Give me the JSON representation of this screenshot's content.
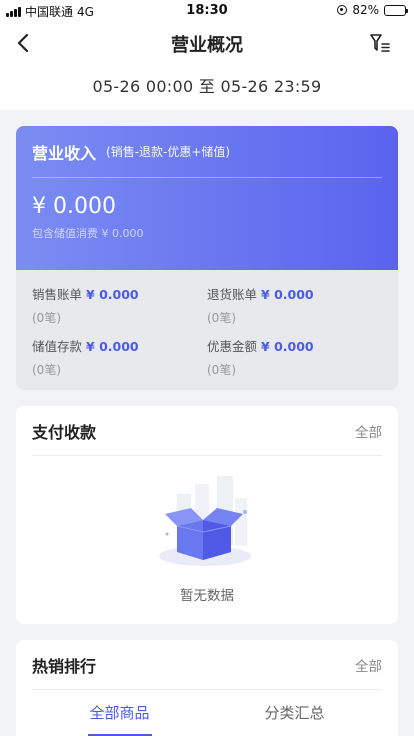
{
  "status": {
    "carrier": "中国联通",
    "network": "4G",
    "time": "18:30",
    "battery_pct": 0.82,
    "battery_label": "82%"
  },
  "nav": {
    "title": "营业概况"
  },
  "date_range": "05-26 00:00 至 05-26 23:59",
  "revenue": {
    "title": "营业收入",
    "formula": "(销售-退款-优惠+储值)",
    "amount": "¥ 0.000",
    "subtext": "包含储值消费 ¥ 0.000",
    "stats": [
      {
        "label": "销售账单",
        "value": "¥ 0.000",
        "count": "(0笔)"
      },
      {
        "label": "退货账单",
        "value": "¥ 0.000",
        "count": "(0笔)"
      },
      {
        "label": "储值存款",
        "value": "¥ 0.000",
        "count": "(0笔)"
      },
      {
        "label": "优惠金额",
        "value": "¥ 0.000",
        "count": "(0笔)"
      }
    ]
  },
  "payment": {
    "title": "支付收款",
    "link": "全部",
    "empty_text": "暂无数据",
    "icon": "empty-box-icon"
  },
  "hot": {
    "title": "热销排行",
    "link": "全部",
    "tabs": [
      "全部商品",
      "分类汇总"
    ],
    "active_tab": 0
  },
  "colors": {
    "accent": "#4b5be6",
    "card_gradient_start": "#7b8df2",
    "card_gradient_end": "#5b63ef"
  }
}
